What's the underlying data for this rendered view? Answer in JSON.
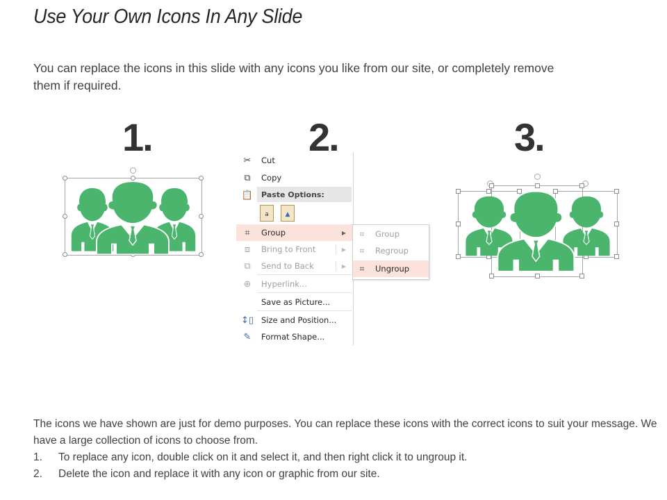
{
  "slide": {
    "title": "Use Your Own Icons In Any Slide",
    "intro": "You can replace the icons in this slide with any icons you like from our site, or completely remove them if required.",
    "steps": [
      {
        "number": "1.",
        "icon": "business-team-icon",
        "state": "grouped-selected"
      },
      {
        "number": "2.",
        "icon": "context-menu",
        "state": "ungroup-menu"
      },
      {
        "number": "3.",
        "icon": "business-team-icon",
        "state": "ungrouped-selected"
      }
    ],
    "icon_color": "#4bb56e",
    "context_menu": {
      "items": [
        {
          "label": "Cut",
          "icon": "scissors-icon",
          "enabled": true
        },
        {
          "label": "Copy",
          "icon": "copy-icon",
          "enabled": true
        },
        {
          "label": "Paste Options:",
          "icon": "paste-icon",
          "enabled": true,
          "header": true
        },
        {
          "label": "Group",
          "icon": "group-icon",
          "enabled": true,
          "submenu": true,
          "highlighted": true
        },
        {
          "label": "Bring to Front",
          "icon": "bring-front-icon",
          "enabled": false,
          "submenu": true
        },
        {
          "label": "Send to Back",
          "icon": "send-back-icon",
          "enabled": false,
          "submenu": true
        },
        {
          "label": "Hyperlink...",
          "icon": "hyperlink-icon",
          "enabled": false
        },
        {
          "label": "Save as Picture...",
          "icon": "",
          "enabled": true
        },
        {
          "label": "Size and Position...",
          "icon": "size-position-icon",
          "enabled": true
        },
        {
          "label": "Format Shape...",
          "icon": "format-shape-icon",
          "enabled": true
        }
      ],
      "submenu": [
        {
          "label": "Group",
          "icon": "group-icon",
          "enabled": false
        },
        {
          "label": "Regroup",
          "icon": "regroup-icon",
          "enabled": false
        },
        {
          "label": "Ungroup",
          "icon": "ungroup-icon",
          "enabled": true,
          "highlighted": true
        }
      ],
      "highlight_color": "#fbe3dc"
    },
    "outro": {
      "paragraph": "The icons we have shown are just for demo purposes. You can replace these icons with the correct icons to suit your message. We have a large collection of icons to choose from.",
      "list": [
        {
          "n": "1.",
          "text": "To replace any icon, double click on it and select it, and then right click it to ungroup it."
        },
        {
          "n": "2.",
          "text": "Delete the icon and replace it with any icon or graphic from our site."
        }
      ]
    }
  }
}
